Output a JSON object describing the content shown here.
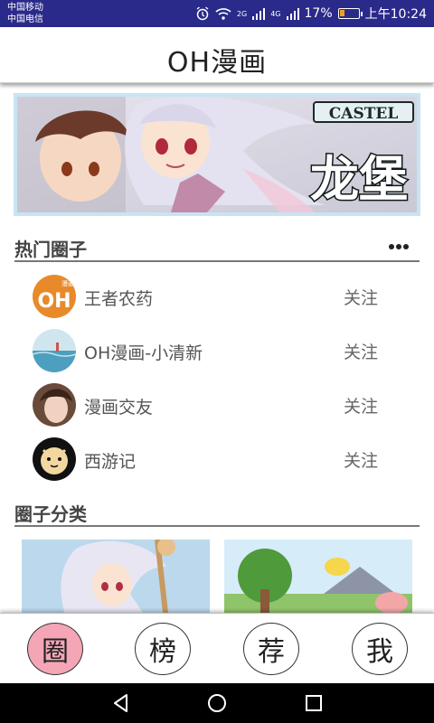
{
  "status_bar": {
    "carrier_1": "中国移动",
    "carrier_2": "中国电信",
    "network_1": "2G",
    "network_2": "4G",
    "battery": "17%",
    "time": "上午10:24",
    "icons": [
      "alarm-icon",
      "wifi-icon",
      "signal-icon",
      "battery-icon"
    ]
  },
  "app_bar": {
    "title": "OH漫画"
  },
  "banner": {
    "logo_en": "CASTEL",
    "logo_cn": "龙堡"
  },
  "hot_circles": {
    "title": "热门圈子",
    "more_icon": "more-dots-icon",
    "items": [
      {
        "name": "王者农药",
        "action": "关注",
        "avatar_text": "OH",
        "avatar_sub": "漫画",
        "color": "#e88a2a"
      },
      {
        "name": "OH漫画-小清新",
        "action": "关注",
        "color": "#5aa7c9"
      },
      {
        "name": "漫画交友",
        "action": "关注",
        "color": "#9a6b5a"
      },
      {
        "name": "西游记",
        "action": "关注",
        "color": "#f2d8a0"
      }
    ]
  },
  "categories": {
    "title": "圈子分类"
  },
  "bottom_nav": [
    {
      "label": "圈",
      "active": true
    },
    {
      "label": "榜",
      "active": false
    },
    {
      "label": "荐",
      "active": false
    },
    {
      "label": "我",
      "active": false
    }
  ],
  "colors": {
    "status_bar": "#2a2a8a",
    "nav_active": "#f4a6b6",
    "divider": "#777777",
    "banner_border": "#c8e4f2"
  }
}
